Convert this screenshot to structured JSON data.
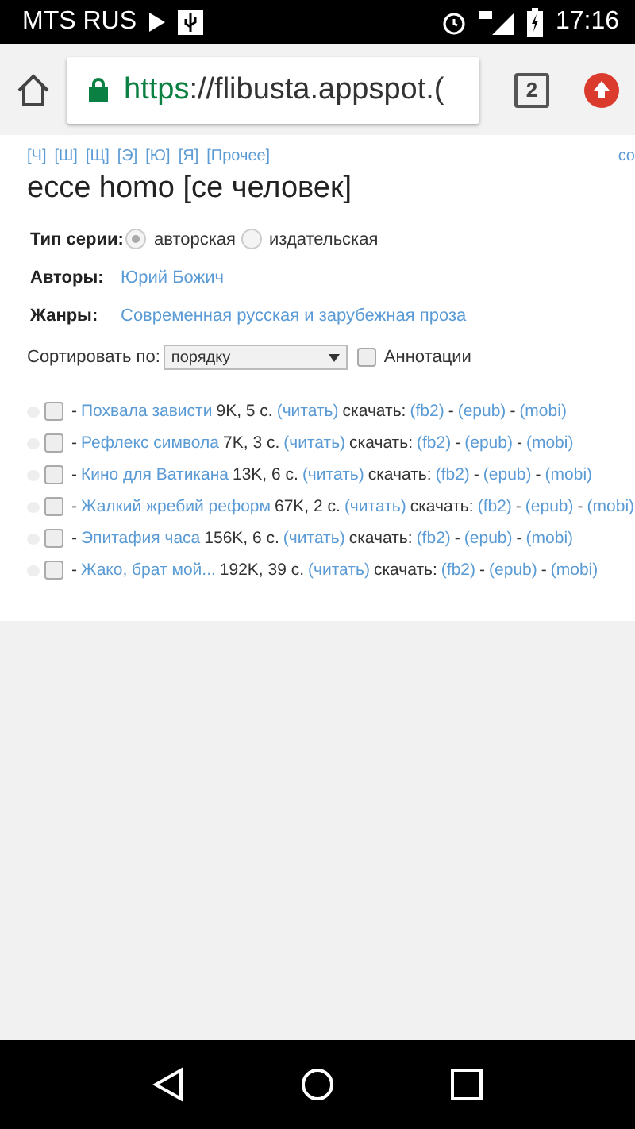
{
  "status_bar": {
    "carrier": "MTS RUS",
    "time": "17:16"
  },
  "browser": {
    "url_scheme": "https",
    "url_rest": "://flibusta.appspot.(",
    "tab_count": "2"
  },
  "alphabet_links": [
    "[Ч]",
    "[Ш]",
    "[Щ]",
    "[Э]",
    "[Ю]",
    "[Я]",
    "[Прочее]"
  ],
  "alphabet_right": "со",
  "title": "ecce homo [се человек]",
  "series_type": {
    "label": "Тип серии:",
    "options": [
      {
        "label": "авторская",
        "selected": true
      },
      {
        "label": "издательская",
        "selected": false
      }
    ]
  },
  "fields": [
    {
      "label": "Авторы:",
      "value": "Юрий Божич"
    },
    {
      "label": "Жанры:",
      "value": "Современная русская и зарубежная проза"
    }
  ],
  "sort": {
    "label": "Сортировать по:",
    "value": "порядку",
    "annotations": {
      "label": "Аннотации",
      "checked": false
    }
  },
  "books": [
    {
      "separator": "-",
      "title": "Похвала зависти",
      "size": "9K, 5 с.",
      "read": "(читать)",
      "download_label": "скачать:",
      "formats": [
        "(fb2)",
        "(epub)",
        "(mobi)"
      ],
      "checked": false
    },
    {
      "separator": "-",
      "title": "Рефлекс символа",
      "size": "7K, 3 с.",
      "read": "(читать)",
      "download_label": "скачать:",
      "formats": [
        "(fb2)",
        "(epub)",
        "(mobi)"
      ],
      "checked": false
    },
    {
      "separator": "-",
      "title": "Кино для Ватикана",
      "size": "13K, 6 с.",
      "read": "(читать)",
      "download_label": "скачать:",
      "formats": [
        "(fb2)",
        "(epub)",
        "(mobi)"
      ],
      "checked": false
    },
    {
      "separator": "-",
      "title": "Жалкий жребий реформ",
      "size": "67K, 2 с.",
      "read": "(читать)",
      "download_label": "скачать:",
      "formats": [
        "(fb2)",
        "(epub)",
        "(mobi)"
      ],
      "checked": false
    },
    {
      "separator": "-",
      "title": "Эпитафия часа",
      "size": "156K, 6 с.",
      "read": "(читать)",
      "download_label": "скачать:",
      "formats": [
        "(fb2)",
        "(epub)",
        "(mobi)"
      ],
      "checked": false
    },
    {
      "separator": "-",
      "title": "Жако, брат мой...",
      "size": "192K, 39 с.",
      "read": "(читать)",
      "download_label": "скачать:",
      "formats": [
        "(fb2)",
        "(epub)",
        "(mobi)"
      ],
      "checked": false
    }
  ]
}
